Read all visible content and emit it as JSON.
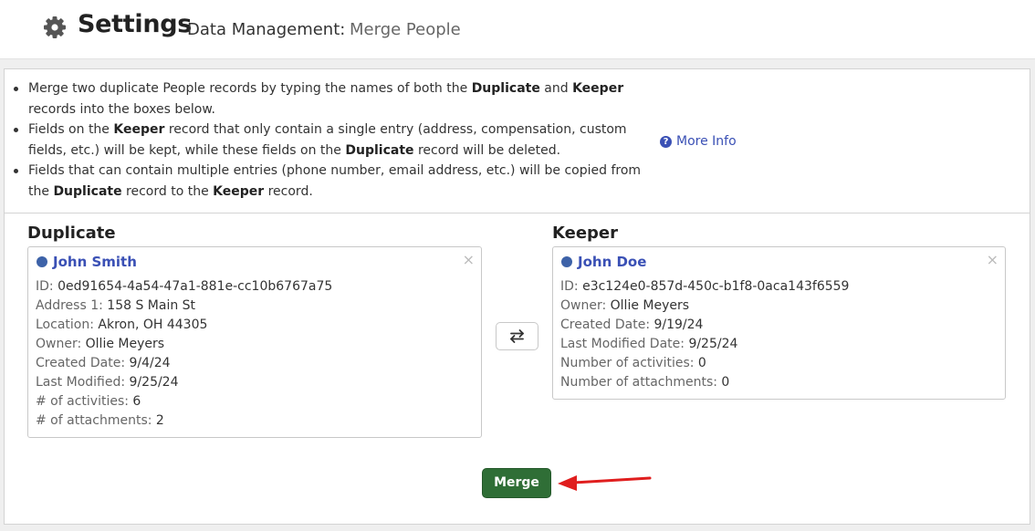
{
  "header": {
    "title": "Settings",
    "crumb_section": "Data Management:",
    "crumb_page": "Merge People",
    "icon": "gear-icon"
  },
  "intro": {
    "bullet1": {
      "t1": "Merge two duplicate People records by typing the names of both the ",
      "b1": "Duplicate",
      "t2": " and ",
      "b2": "Keeper",
      "t3": " records into the boxes below."
    },
    "bullet2": {
      "t1": "Fields on the ",
      "b1": "Keeper",
      "t2": " record that only contain a single entry (address, compensation, custom fields, etc.) will be kept, while these fields on the ",
      "b2": "Duplicate",
      "t3": " record will be deleted."
    },
    "bullet3": {
      "t1": "Fields that can contain multiple entries (phone number, email address, etc.) will be copied from the ",
      "b1": "Duplicate",
      "t2": " record to the ",
      "b2": "Keeper",
      "t3": " record."
    },
    "more_info": "More Info",
    "more_info_icon": "question-circle-icon"
  },
  "duplicate": {
    "heading": "Duplicate",
    "name": "John Smith",
    "close": "×",
    "rows": [
      {
        "label": "ID: ",
        "value": "0ed91654-4a54-47a1-881e-cc10b6767a75"
      },
      {
        "label": "Address 1: ",
        "value": "158 S Main St"
      },
      {
        "label": "Location: ",
        "value": "Akron, OH 44305"
      },
      {
        "label": "Owner: ",
        "value": "Ollie Meyers"
      },
      {
        "label": "Created Date: ",
        "value": "9/4/24"
      },
      {
        "label": "Last Modified: ",
        "value": "9/25/24"
      },
      {
        "label": "# of activities: ",
        "value": "6"
      },
      {
        "label": "# of attachments: ",
        "value": "2"
      }
    ]
  },
  "keeper": {
    "heading": "Keeper",
    "name": "John Doe",
    "close": "×",
    "rows": [
      {
        "label": "ID: ",
        "value": "e3c124e0-857d-450c-b1f8-0aca143f6559"
      },
      {
        "label": "Owner: ",
        "value": "Ollie Meyers"
      },
      {
        "label": "Created Date: ",
        "value": "9/19/24"
      },
      {
        "label": "Last Modified Date: ",
        "value": "9/25/24"
      },
      {
        "label": "Number of activities: ",
        "value": "0"
      },
      {
        "label": "Number of attachments: ",
        "value": "0"
      }
    ]
  },
  "actions": {
    "swap_icon": "swap-arrows-icon",
    "merge_label": "Merge",
    "annotation_icon": "red-arrow-icon"
  },
  "colors": {
    "accent": "#3a50b5",
    "merge_button": "#2f6e36",
    "annotation": "#e01e1e"
  }
}
